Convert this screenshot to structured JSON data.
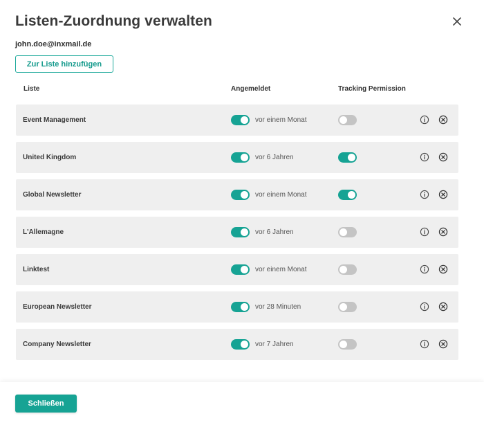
{
  "dialog": {
    "title": "Listen-Zuordnung verwalten",
    "email": "john.doe@inxmail.de",
    "add_button_label": "Zur Liste hinzufügen",
    "close_icon": "close-icon"
  },
  "table": {
    "headers": {
      "liste": "Liste",
      "angemeldet": "Angemeldet",
      "tracking": "Tracking Permission"
    },
    "rows": [
      {
        "name": "Event Management",
        "subscribed": true,
        "since": "vor einem Monat",
        "tracking": false
      },
      {
        "name": "United Kingdom",
        "subscribed": true,
        "since": "vor 6 Jahren",
        "tracking": true
      },
      {
        "name": "Global Newsletter",
        "subscribed": true,
        "since": "vor einem Monat",
        "tracking": true
      },
      {
        "name": "L'Allemagne",
        "subscribed": true,
        "since": "vor 6 Jahren",
        "tracking": false
      },
      {
        "name": "Linktest",
        "subscribed": true,
        "since": "vor einem Monat",
        "tracking": false
      },
      {
        "name": "European Newsletter",
        "subscribed": true,
        "since": "vor 28 Minuten",
        "tracking": false
      },
      {
        "name": "Company Newsletter",
        "subscribed": true,
        "since": "vor 7 Jahren",
        "tracking": false
      }
    ],
    "row_icons": [
      "info-icon",
      "remove-icon"
    ]
  },
  "footer": {
    "close_button_label": "Schließen"
  },
  "colors": {
    "accent": "#16a394",
    "toggle_off": "#c4c4c4",
    "row_background": "#efefef"
  }
}
